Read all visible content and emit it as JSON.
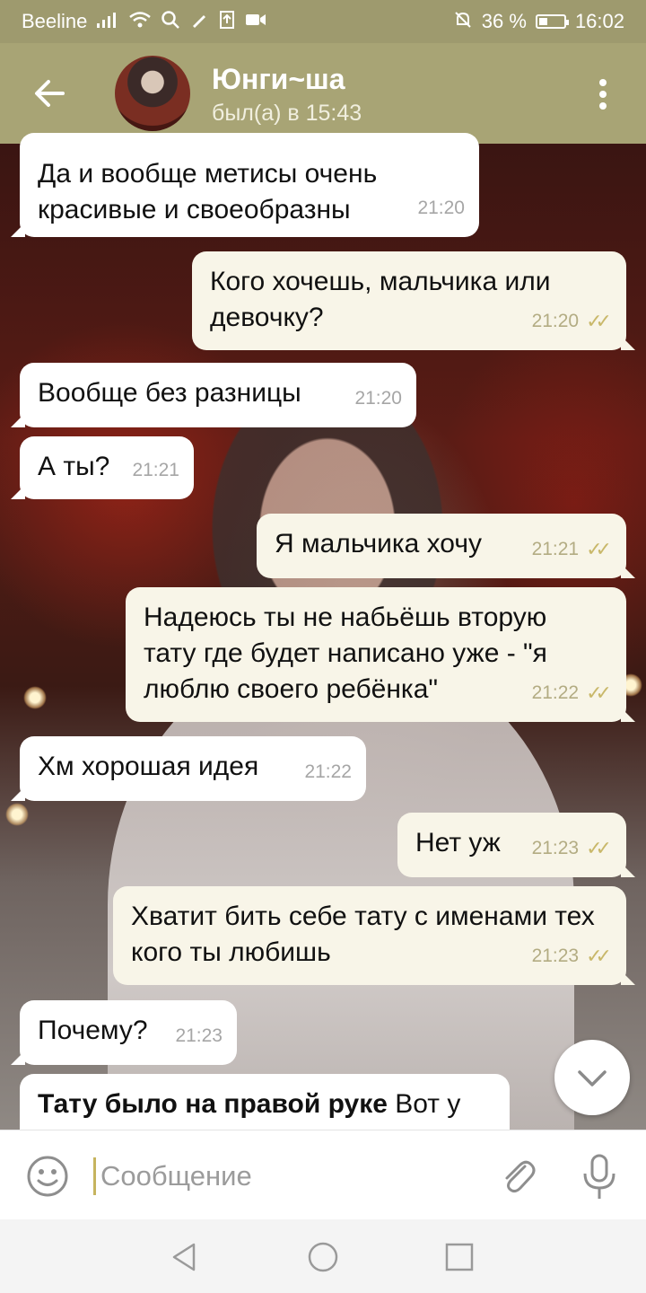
{
  "status_bar": {
    "carrier": "Beeline",
    "battery": "36 %",
    "time": "16:02"
  },
  "header": {
    "contact_name": "Юнги~ша",
    "last_seen": "был(а) в 15:43"
  },
  "messages": [
    {
      "dir": "in",
      "text": "Да и вообще метисы очень красивые и своеобразны",
      "time": "21:20"
    },
    {
      "dir": "out",
      "text": "Кого хочешь, мальчика или девочку?",
      "time": "21:20"
    },
    {
      "dir": "in",
      "text": "Вообще без разницы",
      "time": "21:20"
    },
    {
      "dir": "in",
      "text": "А ты?",
      "time": "21:21"
    },
    {
      "dir": "out",
      "text": "Я мальчика хочу",
      "time": "21:21"
    },
    {
      "dir": "out",
      "text": "Надеюсь ты не набьёшь вторую тату где будет написано уже - \"я люблю своего ребёнка\"",
      "time": "21:22"
    },
    {
      "dir": "in",
      "text": "Хм хорошая идея",
      "time": "21:22"
    },
    {
      "dir": "out",
      "text": "Нет уж",
      "time": "21:23"
    },
    {
      "dir": "out",
      "text": "Хватит бить себе тату с именами тех кого ты любишь",
      "time": "21:23"
    },
    {
      "dir": "in",
      "text": "Почему?",
      "time": "21:23"
    },
    {
      "dir": "in",
      "bold_text": "Тату было на правой руке",
      "text": " Вот у"
    }
  ],
  "input": {
    "placeholder": "Сообщение"
  },
  "colors": {
    "status_bar": "#9e9a6e",
    "top_bar": "#a8a475",
    "incoming_bubble": "#ffffff",
    "outgoing_bubble": "#f8f5e8",
    "read_ticks": "#c9b86a"
  },
  "icons": {
    "back": "arrow-left-icon",
    "menu": "more-vertical-icon",
    "scroll": "chevron-down-icon",
    "emoji": "smiley-icon",
    "attach": "paperclip-icon",
    "mic": "microphone-icon",
    "nav": [
      "back-triangle-icon",
      "home-circle-icon",
      "recents-square-icon"
    ]
  }
}
